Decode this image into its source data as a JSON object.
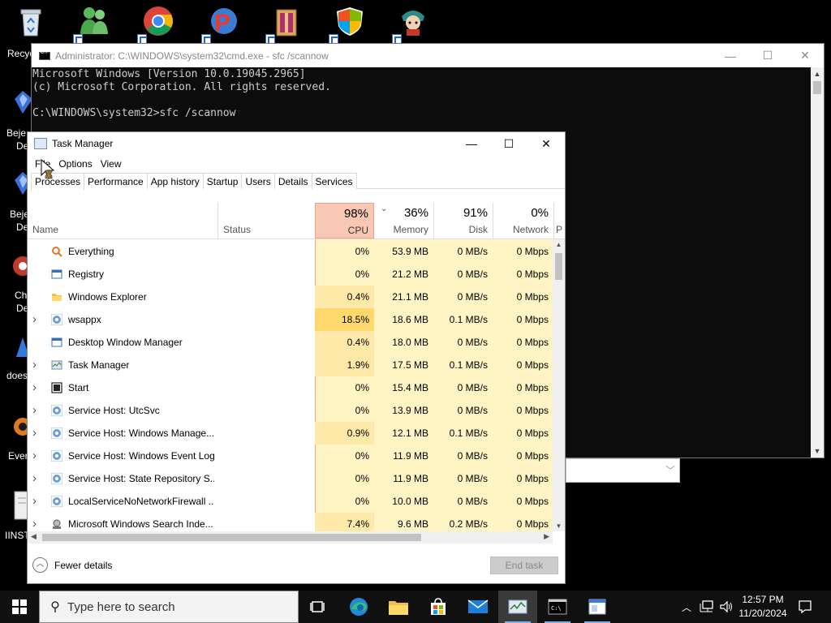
{
  "desktop": {
    "icons": [
      {
        "name": "recycle-bin-icon",
        "label": "Recyc"
      },
      {
        "name": "messenger-icon",
        "label": ""
      },
      {
        "name": "chrome-icon",
        "label": ""
      },
      {
        "name": "game-p-icon",
        "label": ""
      },
      {
        "name": "winrar-icon",
        "label": ""
      },
      {
        "name": "windows-security-icon",
        "label": ""
      },
      {
        "name": "game-character-icon",
        "label": ""
      }
    ],
    "left_labels": [
      "Beje",
      "De",
      "Beje",
      "De",
      "Ch",
      "De",
      "does",
      "Ever",
      "IINST"
    ]
  },
  "cmd": {
    "title": "Administrator: C:\\WINDOWS\\system32\\cmd.exe - sfc  /scannow",
    "lines": [
      "Microsoft Windows [Version 10.0.19045.2965]",
      "(c) Microsoft Corporation. All rights reserved.",
      "",
      "C:\\WINDOWS\\system32>sfc /scannow"
    ],
    "minimize": "—",
    "maximize": "☐",
    "close": "✕"
  },
  "taskmanager": {
    "title": "Task Manager",
    "menu": [
      "File",
      "Options",
      "View"
    ],
    "tabs": [
      "Processes",
      "Performance",
      "App history",
      "Startup",
      "Users",
      "Details",
      "Services"
    ],
    "columns": {
      "name": "Name",
      "status": "Status",
      "cpu": {
        "pct": "98%",
        "label": "CPU"
      },
      "memory": {
        "pct": "36%",
        "label": "Memory"
      },
      "disk": {
        "pct": "91%",
        "label": "Disk"
      },
      "network": {
        "pct": "0%",
        "label": "Network"
      },
      "power": "P"
    },
    "processes": [
      {
        "name": "Everything",
        "cpu": "0%",
        "mem": "53.9 MB",
        "disk": "0 MB/s",
        "net": "0 Mbps",
        "expand": false,
        "icon": "magnifier-icon"
      },
      {
        "name": "Registry",
        "cpu": "0%",
        "mem": "21.2 MB",
        "disk": "0 MB/s",
        "net": "0 Mbps",
        "expand": false,
        "icon": "window-icon"
      },
      {
        "name": "Windows Explorer",
        "cpu": "0.4%",
        "mem": "21.1 MB",
        "disk": "0 MB/s",
        "net": "0 Mbps",
        "expand": false,
        "icon": "folder-icon"
      },
      {
        "name": "wsappx",
        "cpu": "18.5%",
        "mem": "18.6 MB",
        "disk": "0.1 MB/s",
        "net": "0 Mbps",
        "expand": true,
        "icon": "gear-icon"
      },
      {
        "name": "Desktop Window Manager",
        "cpu": "0.4%",
        "mem": "18.0 MB",
        "disk": "0 MB/s",
        "net": "0 Mbps",
        "expand": false,
        "icon": "window-icon"
      },
      {
        "name": "Task Manager",
        "cpu": "1.9%",
        "mem": "17.5 MB",
        "disk": "0.1 MB/s",
        "net": "0 Mbps",
        "expand": true,
        "icon": "taskmanager-icon"
      },
      {
        "name": "Start",
        "cpu": "0%",
        "mem": "15.4 MB",
        "disk": "0 MB/s",
        "net": "0 Mbps",
        "expand": true,
        "icon": "start-icon"
      },
      {
        "name": "Service Host: UtcSvc",
        "cpu": "0%",
        "mem": "13.9 MB",
        "disk": "0 MB/s",
        "net": "0 Mbps",
        "expand": true,
        "icon": "gear-icon"
      },
      {
        "name": "Service Host: Windows Manage...",
        "cpu": "0.9%",
        "mem": "12.1 MB",
        "disk": "0.1 MB/s",
        "net": "0 Mbps",
        "expand": true,
        "icon": "gear-icon"
      },
      {
        "name": "Service Host: Windows Event Log",
        "cpu": "0%",
        "mem": "11.9 MB",
        "disk": "0 MB/s",
        "net": "0 Mbps",
        "expand": true,
        "icon": "gear-icon"
      },
      {
        "name": "Service Host: State Repository S...",
        "cpu": "0%",
        "mem": "11.9 MB",
        "disk": "0 MB/s",
        "net": "0 Mbps",
        "expand": true,
        "icon": "gear-icon"
      },
      {
        "name": "LocalServiceNoNetworkFirewall ...",
        "cpu": "0%",
        "mem": "10.0 MB",
        "disk": "0 MB/s",
        "net": "0 Mbps",
        "expand": true,
        "icon": "gear-icon"
      },
      {
        "name": "Microsoft Windows Search Inde...",
        "cpu": "7.4%",
        "mem": "9.6 MB",
        "disk": "0.2 MB/s",
        "net": "0 Mbps",
        "expand": true,
        "icon": "search-indexer-icon"
      }
    ],
    "fewer_details": "Fewer details",
    "end_task": "End task"
  },
  "taskbar": {
    "search_placeholder": "Type here to search",
    "time": "12:57 PM",
    "date": "11/20/2024"
  },
  "colors": {
    "cpu_header": "#f9c8b4",
    "heat_light": "#fff4c4",
    "heat_medium": "#ffe9a8",
    "heat_high": "#ffd96e",
    "taskbar": "#101010",
    "cmd_bg": "#0c0c0c"
  }
}
